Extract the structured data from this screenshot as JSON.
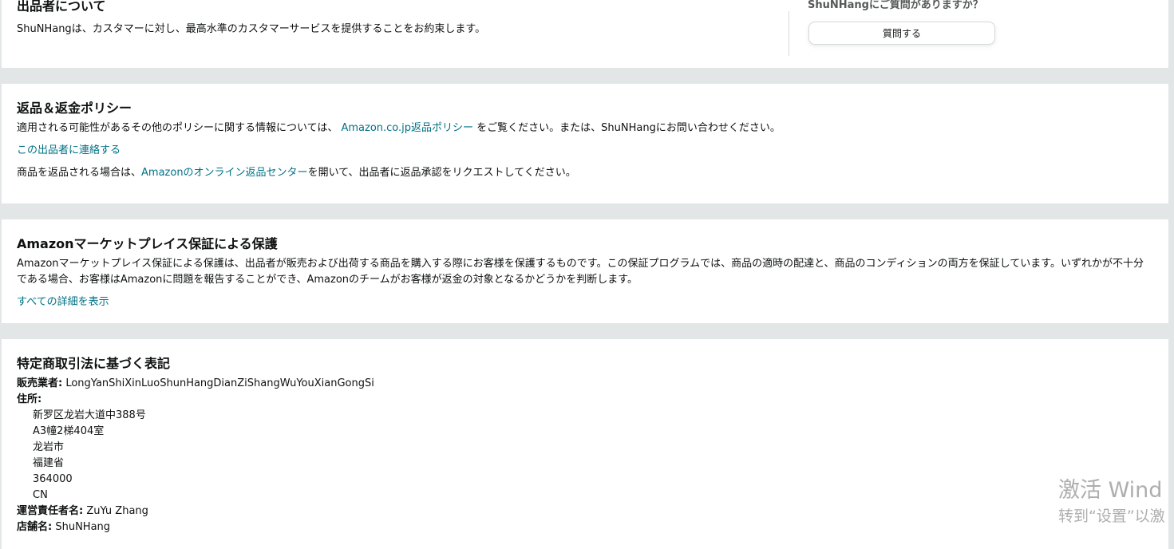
{
  "about": {
    "title": "出品者について",
    "desc": "ShuNHangは、カスタマーに対し、最高水準のカスタマーサービスを提供することをお約束します。",
    "question_label": "ShuNHangにご質問がありますか？",
    "ask_button": "質問する"
  },
  "returns": {
    "title": "返品＆返金ポリシー",
    "line1_pre": "適用される可能性があるその他のポリシーに関する情報については、 ",
    "line1_link": "Amazon.co.jp返品ポリシー",
    "line1_post": " をご覧ください。または、ShuNHangにお問い合わせください。",
    "contact_link": "この出品者に連絡する",
    "line2_pre": "商品を返品される場合は、",
    "line2_link": "Amazonのオンライン返品センター",
    "line2_post": "を開いて、出品者に返品承認をリクエストしてください。"
  },
  "guarantee": {
    "title": "Amazonマーケットプレイス保証による保護",
    "desc": "Amazonマーケットプレイス保証による保護は、出品者が販売および出荷する商品を購入する際にお客様を保護するものです。この保証プログラムでは、商品の適時の配達と、商品のコンディションの両方を保証しています。いずれかが不十分である場合、お客様はAmazonに問題を報告することができ、Amazonのチームがお客様が返金の対象となるかどうかを判断します。",
    "details_link": "すべての詳細を表示"
  },
  "legal": {
    "title": "特定商取引法に基づく表記",
    "seller_label": "販売業者:",
    "seller_value": " LongYanShiXinLuoShunHangDianZiShangWuYouXianGongSi",
    "address_label": "住所:",
    "address_lines": [
      "新罗区龙岩大道中388号",
      "A3幢2梯404室",
      "龙岩市",
      "福建省",
      "364000",
      "CN"
    ],
    "manager_label": "運営責任者名:",
    "manager_value": " ZuYu Zhang",
    "store_label": "店舗名:",
    "store_value": " ShuNHang"
  },
  "watermark": {
    "line1": "激活 Wind",
    "line2": "转到“设置”以激"
  }
}
